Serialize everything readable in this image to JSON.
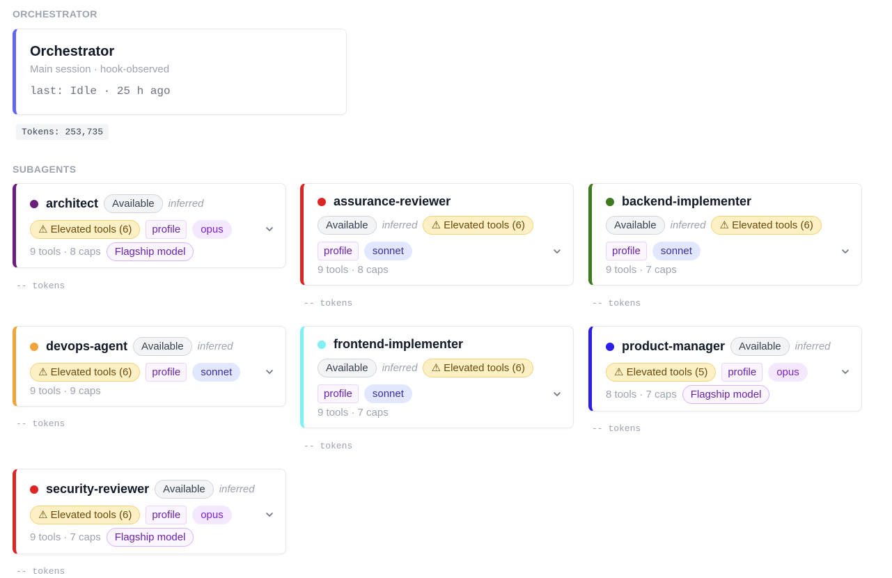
{
  "orchestrator": {
    "section_label": "ORCHESTRATOR",
    "title": "Orchestrator",
    "subtitle": "Main session · hook-observed",
    "last_status": "last: Idle · 25 h ago",
    "tokens": "Tokens: 253,735"
  },
  "subagents": {
    "section_label": "SUBAGENTS",
    "agents": [
      {
        "name": "architect",
        "dot_color": "#6b1f7b",
        "border_color": "#6b1f7b",
        "available": "Available",
        "inferred": "inferred",
        "elevated": "⚠ Elevated tools (6)",
        "profile": "profile",
        "model": "opus",
        "meta": "9 tools · 8 caps",
        "flagship": "Flagship model",
        "tokens": "-- tokens"
      },
      {
        "name": "assurance-reviewer",
        "dot_color": "#dc2626",
        "border_color": "#dc2626",
        "available": "Available",
        "inferred": "inferred",
        "elevated": "⚠ Elevated tools (6)",
        "profile": "profile",
        "model": "sonnet",
        "meta": "9 tools · 8 caps",
        "flagship": "",
        "tokens": "-- tokens"
      },
      {
        "name": "backend-implementer",
        "dot_color": "#3f7a1f",
        "border_color": "#3f7a1f",
        "available": "Available",
        "inferred": "inferred",
        "elevated": "⚠ Elevated tools (6)",
        "profile": "profile",
        "model": "sonnet",
        "meta": "9 tools · 7 caps",
        "flagship": "",
        "tokens": "-- tokens"
      },
      {
        "name": "devops-agent",
        "dot_color": "#f0a33a",
        "border_color": "#f0a33a",
        "available": "Available",
        "inferred": "inferred",
        "elevated": "⚠ Elevated tools (6)",
        "profile": "profile",
        "model": "sonnet",
        "meta": "9 tools · 9 caps",
        "flagship": "",
        "tokens": "-- tokens"
      },
      {
        "name": "frontend-implementer",
        "dot_color": "#7ff0f5",
        "border_color": "#7ff0f5",
        "available": "Available",
        "inferred": "inferred",
        "elevated": "⚠ Elevated tools (6)",
        "profile": "profile",
        "model": "sonnet",
        "meta": "9 tools · 7 caps",
        "flagship": "",
        "tokens": "-- tokens"
      },
      {
        "name": "product-manager",
        "dot_color": "#2b1fe6",
        "border_color": "#2b1fe6",
        "available": "Available",
        "inferred": "inferred",
        "elevated": "⚠ Elevated tools (5)",
        "profile": "profile",
        "model": "opus",
        "meta": "8 tools · 7 caps",
        "flagship": "Flagship model",
        "tokens": "-- tokens"
      },
      {
        "name": "security-reviewer",
        "dot_color": "#dc2626",
        "border_color": "#dc2626",
        "available": "Available",
        "inferred": "inferred",
        "elevated": "⚠ Elevated tools (6)",
        "profile": "profile",
        "model": "opus",
        "meta": "9 tools · 7 caps",
        "flagship": "Flagship model",
        "tokens": "-- tokens"
      }
    ]
  },
  "icons": {
    "expand": "chevron-down-icon",
    "status": "status-dot-icon"
  }
}
